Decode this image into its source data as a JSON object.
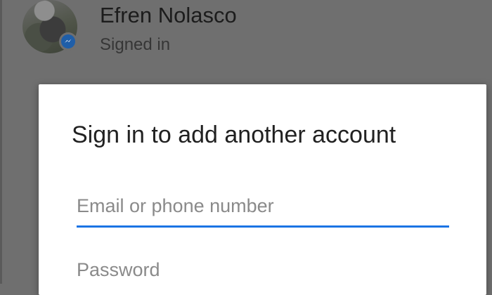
{
  "account": {
    "name": "Efren Nolasco",
    "status": "Signed in",
    "avatar_icon": "user-photo-avatar",
    "badge_icon": "messenger-icon",
    "badge_color": "#1f5ea8"
  },
  "dialog": {
    "title": "Sign in to add another account",
    "email_placeholder": "Email or phone number",
    "email_value": "",
    "password_placeholder": "Password",
    "password_value": ""
  },
  "colors": {
    "scrim": "#6f6f6f",
    "accent": "#1b74e4",
    "dialog_bg": "#ffffff"
  }
}
